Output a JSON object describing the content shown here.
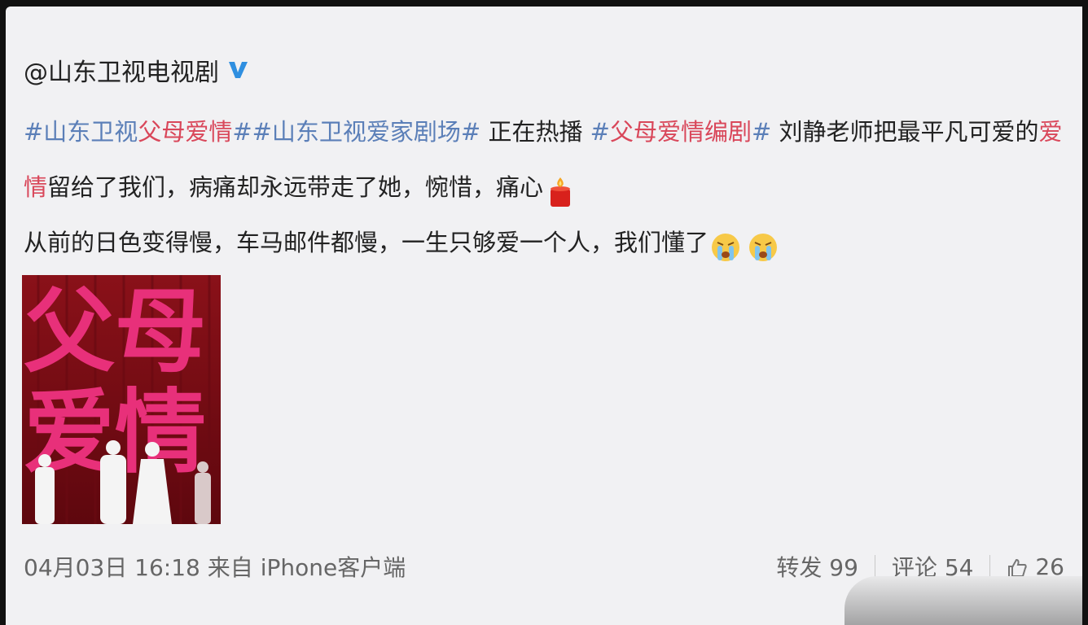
{
  "post": {
    "author": "@山东卫视电视剧",
    "verified_icon": "verified-v-icon",
    "lines": [
      {
        "parts": [
          {
            "text": "#山东卫视",
            "style": "blue"
          },
          {
            "text": "父母爱情",
            "style": "red"
          },
          {
            "text": "##山东卫视爱家剧场#",
            "style": "blue"
          },
          {
            "text": " 正在热播 ",
            "style": "plain"
          },
          {
            "text": "#",
            "style": "blue"
          },
          {
            "text": "父母爱情编剧",
            "style": "red"
          },
          {
            "text": "#",
            "style": "blue"
          },
          {
            "text": " 刘静老师把最平凡可爱的",
            "style": "plain"
          },
          {
            "text": "爱",
            "style": "red"
          }
        ]
      },
      {
        "parts": [
          {
            "text": "情",
            "style": "red"
          },
          {
            "text": "留给了我们，病痛却永远带走了她，惋惜，痛心",
            "style": "plain"
          }
        ],
        "emojis": [
          "candle-icon"
        ]
      },
      {
        "parts": [
          {
            "text": "从前的日色变得慢，车马邮件都慢，一生只够爱一个人，我们懂了",
            "style": "plain"
          }
        ],
        "emojis": [
          "crying-face-icon",
          "crying-face-icon"
        ]
      }
    ],
    "poster": {
      "title_line1": "父母",
      "title_line2": "爱情",
      "accent_color": "#e8307a",
      "background_color": "#7d0d16"
    },
    "meta": {
      "date": "04月03日",
      "time": "16:18",
      "source_prefix": "来自",
      "source": "iPhone客户端"
    },
    "actions": {
      "repost_label": "转发",
      "repost_count": "99",
      "comment_label": "评论",
      "comment_count": "54",
      "like_icon": "thumbs-up-icon",
      "like_count": "26"
    }
  }
}
